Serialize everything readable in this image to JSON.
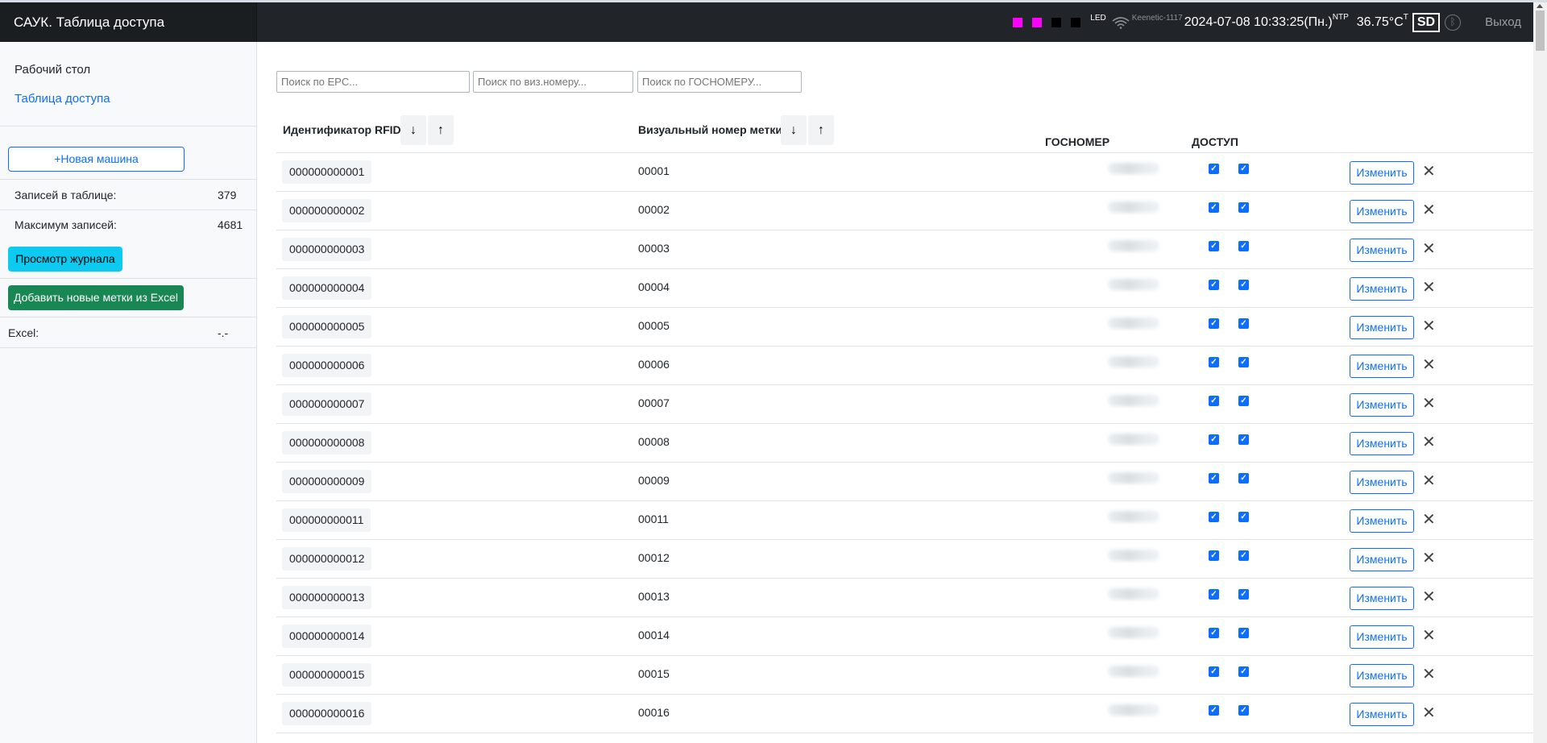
{
  "topbar": {
    "title": "САУК. Таблица доступа",
    "leds": [
      "#ff00ff",
      "#ff00ff",
      "#000000",
      "#000000"
    ],
    "led_label": "LED",
    "network": "Keenetic-1117",
    "datetime": "2024-07-08 10:33:25(Пн.)",
    "datetime_sup": "NTP",
    "temperature": "36.75°C",
    "temperature_sup": "T",
    "sd": "SD",
    "bluetooth_icon": "bluetooth-icon",
    "logout": "Выход"
  },
  "sidebar": {
    "nav": [
      "Рабочий стол",
      "Таблица доступа"
    ],
    "new_car": "+Новая машина",
    "records_label": "Записей в таблице:",
    "records_value": "379",
    "max_label": "Максимум записей:",
    "max_value": "4681",
    "journal": "Просмотр журнала",
    "add_excel": "Добавить новые метки из Excel",
    "excel_label": "Excel:",
    "excel_value": "-.-"
  },
  "search": {
    "epc_placeholder": "Поиск по EPC...",
    "vis_placeholder": "Поиск по виз.номеру...",
    "gos_placeholder": "Поиск по ГОСНОМЕРУ..."
  },
  "table": {
    "headers": {
      "rfid": "Идентификатор RFID",
      "visual": "Визуальный номер метки",
      "gos": "ГОСНОМЕР",
      "access": "ДОСТУП",
      "sort_down": "↓",
      "sort_up": "↑"
    },
    "edit_label": "Изменить",
    "delete_icon": "✕",
    "check": "✓",
    "rows": [
      {
        "epc": "000000000001",
        "vis": "00001"
      },
      {
        "epc": "000000000002",
        "vis": "00002"
      },
      {
        "epc": "000000000003",
        "vis": "00003"
      },
      {
        "epc": "000000000004",
        "vis": "00004"
      },
      {
        "epc": "000000000005",
        "vis": "00005"
      },
      {
        "epc": "000000000006",
        "vis": "00006"
      },
      {
        "epc": "000000000007",
        "vis": "00007"
      },
      {
        "epc": "000000000008",
        "vis": "00008"
      },
      {
        "epc": "000000000009",
        "vis": "00009"
      },
      {
        "epc": "000000000011",
        "vis": "00011"
      },
      {
        "epc": "000000000012",
        "vis": "00012"
      },
      {
        "epc": "000000000013",
        "vis": "00013"
      },
      {
        "epc": "000000000014",
        "vis": "00014"
      },
      {
        "epc": "000000000015",
        "vis": "00015"
      },
      {
        "epc": "000000000016",
        "vis": "00016"
      }
    ]
  }
}
